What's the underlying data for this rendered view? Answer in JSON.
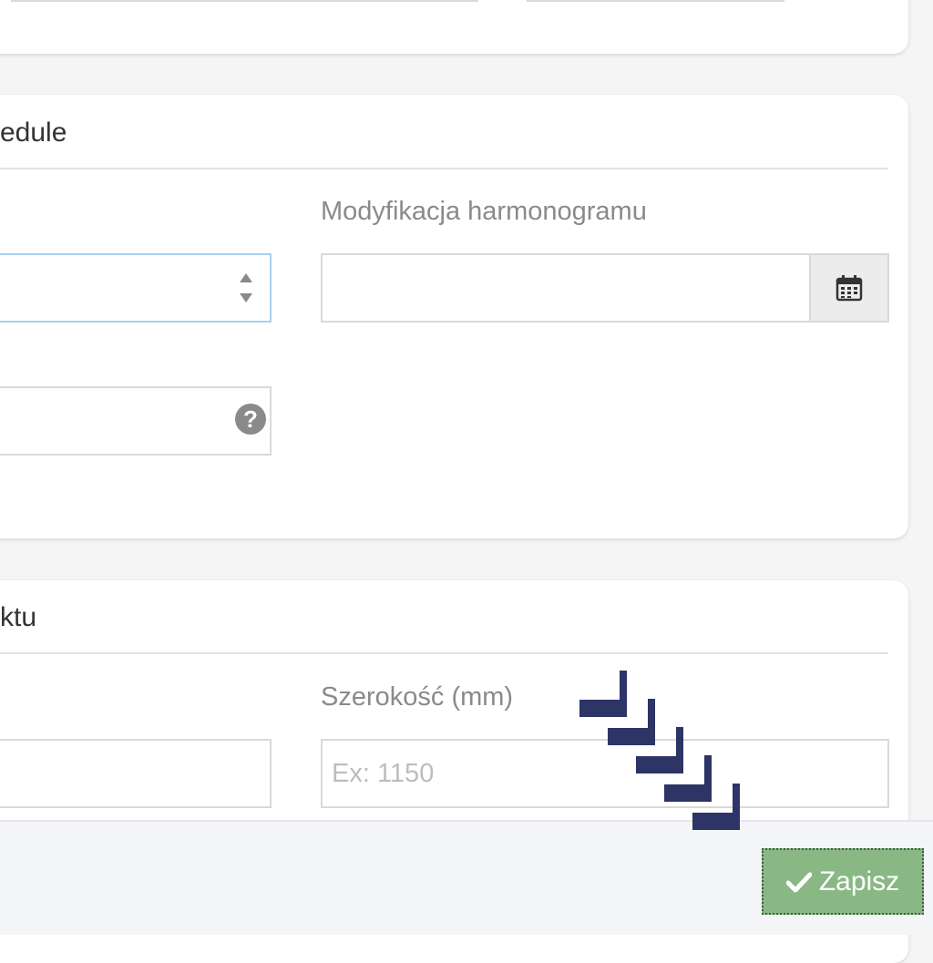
{
  "schedule_section": {
    "title": "edule",
    "modification_label": "Modyfikacja harmonogramu",
    "modification_value": "",
    "number_value": "",
    "help_value": ""
  },
  "product_section": {
    "title": "ktu",
    "width_label": "Szerokość (mm)",
    "width_placeholder": "Ex: 1150",
    "left_value": ""
  },
  "footer": {
    "save_label": "Zapisz"
  },
  "colors": {
    "save_button": "#89b885",
    "arrow": "#2d3566",
    "focus_border": "#a9d1ee"
  },
  "icons": [
    "calendar-icon",
    "question-icon",
    "check-icon",
    "spinner-up-icon",
    "spinner-down-icon"
  ]
}
